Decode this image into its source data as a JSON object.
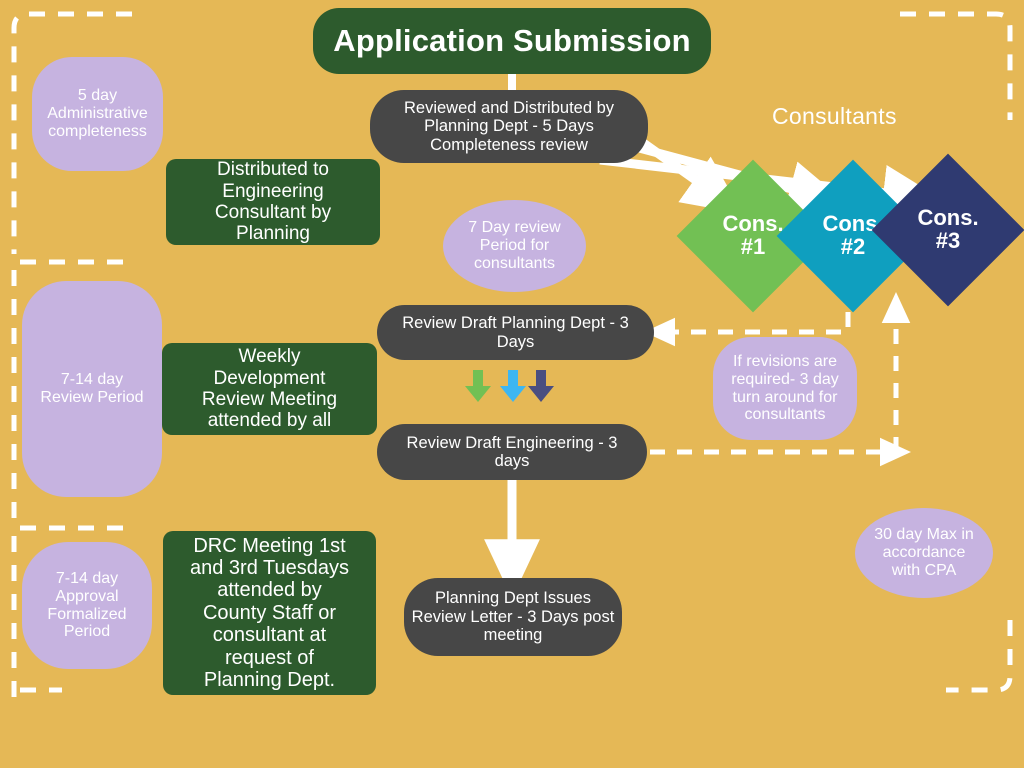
{
  "meta": {
    "background_color": "#e5b856",
    "flow_title": "Application Submission"
  },
  "palette": {
    "background": "#e5b856",
    "green": "#2d5b2d",
    "dark_gray": "#474747",
    "purple": "#c6b3e0",
    "white": "#ffffff",
    "consultant_1": "#72c054",
    "consultant_2": "#0f9fbf",
    "consultant_3": "#2f3a71",
    "arrow_green": "#72c054",
    "arrow_blue": "#3cb6f2",
    "arrow_navy": "#4a4e80"
  },
  "title": {
    "label": "Application Submission"
  },
  "section_labels": {
    "consultants": "Consultants"
  },
  "process_boxes": [
    {
      "id": "reviewed-distributed",
      "label": "Reviewed and Distributed by\nPlanning Dept - 5 Days\nCompleteness review"
    },
    {
      "id": "review-draft-planning",
      "label": "Review Draft Planning Dept - 3\nDays"
    },
    {
      "id": "review-draft-engineering",
      "label": "Review Draft Engineering - 3\ndays"
    },
    {
      "id": "planning-dept-issues-letter",
      "label": "Planning Dept Issues\nReview Letter - 3 Days post\nmeeting"
    }
  ],
  "green_boxes": [
    {
      "id": "distributed-to-engineering",
      "label": "Distributed to\nEngineering\nConsultant by\nPlanning"
    },
    {
      "id": "weekly-development-review-meeting",
      "label": "Weekly\nDevelopment\nReview Meeting\nattended by all"
    },
    {
      "id": "drc-meeting",
      "label": "DRC Meeting 1st\nand 3rd Tuesdays\nattended by\nCounty Staff or\nconsultant at\nrequest of\nPlanning Dept."
    }
  ],
  "timeline_notes": [
    {
      "id": "admin-completeness",
      "label": "5 day\nAdministrative\ncompleteness"
    },
    {
      "id": "review-period",
      "label": "7-14 day\nReview Period"
    },
    {
      "id": "approval-formalized-period",
      "label": "7-14 day\nApproval\nFormalized\nPeriod"
    }
  ],
  "callouts": [
    {
      "id": "seven-day-review",
      "label": "7 Day review\nPeriod for\nconsultants"
    },
    {
      "id": "revisions-turnaround",
      "label": "If revisions are\nrequired- 3 day\nturn around for\nconsultants"
    },
    {
      "id": "thirty-day-max-cpa",
      "label": "30 day Max in\naccordance\nwith CPA"
    }
  ],
  "consultants": [
    {
      "id": "cons-1",
      "line1": "Cons.",
      "line2": "#1",
      "color": "#72c054"
    },
    {
      "id": "cons-2",
      "line1": "Cons.",
      "line2": "#2",
      "color": "#0f9fbf"
    },
    {
      "id": "cons-3",
      "line1": "Cons.",
      "line2": "#3",
      "color": "#2f3a71"
    }
  ],
  "chart_data": {
    "type": "diagram",
    "title": "Application Submission",
    "nodes": [
      "Application Submission",
      "Reviewed and Distributed by Planning Dept - 5 Days Completeness review",
      "Distributed to Engineering Consultant by Planning",
      "Cons. #1",
      "Cons. #2",
      "Cons. #3",
      "Review Draft Planning Dept - 3 Days",
      "Weekly Development Review Meeting attended by all",
      "Review Draft Engineering - 3 days",
      "DRC Meeting 1st and 3rd Tuesdays attended by County Staff or consultant at request of Planning Dept.",
      "Planning Dept Issues Review Letter - 3 Days post meeting"
    ],
    "edges": [
      "Application Submission -> Reviewed and Distributed by Planning Dept",
      "Reviewed and Distributed -> Cons. #1",
      "Reviewed and Distributed -> Cons. #2",
      "Reviewed and Distributed -> Cons. #3",
      "Review Draft Engineering -> Planning Dept Issues Review Letter",
      "Review Draft Planning Dept <- revision loop (dashed)",
      "Review Draft Engineering -> revision loop (dashed) -> Consultants"
    ]
  }
}
